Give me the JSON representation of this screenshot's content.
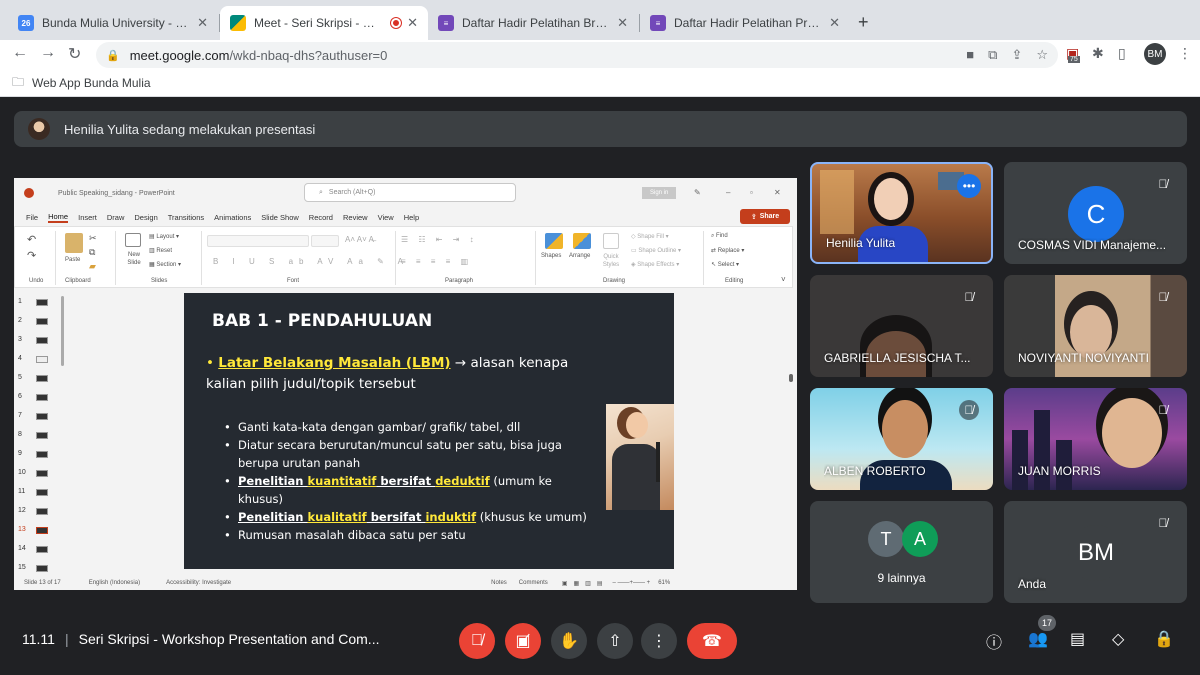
{
  "browser": {
    "tabs": [
      {
        "title": "Bunda Mulia University - Calen",
        "favicon": "calendar-icon",
        "fav_color": "#4285f4",
        "fav_text": "26"
      },
      {
        "title": "Meet - Seri Skripsi - Works",
        "favicon": "meet-icon",
        "fav_color": "#00897b",
        "active": true
      },
      {
        "title": "Daftar Hadir Pelatihan Brevet A",
        "favicon": "forms-icon",
        "fav_color": "#7248b9"
      },
      {
        "title": "Daftar Hadir Pelatihan Present",
        "favicon": "forms-icon",
        "fav_color": "#7248b9"
      }
    ],
    "url_host": "meet.google.com",
    "url_path": "/wkd-nbaq-dhs?authuser=0",
    "bookmark": "Web App Bunda Mulia",
    "profile": "BM",
    "ext_badge": "75"
  },
  "banner": {
    "text": "Henilia Yulita sedang melakukan presentasi"
  },
  "ppt": {
    "title": "Public Speaking_sidang  -  PowerPoint",
    "search_placeholder": "Search (Alt+Q)",
    "signin": "Sign in",
    "menu": [
      "File",
      "Home",
      "Insert",
      "Draw",
      "Design",
      "Transitions",
      "Animations",
      "Slide Show",
      "Record",
      "Review",
      "View",
      "Help"
    ],
    "share": "Share",
    "ribbon_groups": [
      "Undo",
      "Clipboard",
      "Slides",
      "Font",
      "Paragraph",
      "Drawing",
      "Editing"
    ],
    "ribbon_labels": {
      "paste": "Paste",
      "new_slide": "New Slide",
      "layout": "Layout",
      "reset": "Reset",
      "section": "Section",
      "shapes": "Shapes",
      "arrange": "Arrange",
      "quick_styles": "Quick Styles",
      "shape_fill": "Shape Fill",
      "shape_outline": "Shape Outline",
      "shape_effects": "Shape Effects",
      "find": "Find",
      "replace": "Replace",
      "select": "Select"
    },
    "slide_numbers": [
      "1",
      "2",
      "3",
      "4",
      "5",
      "6",
      "7",
      "8",
      "9",
      "10",
      "11",
      "12",
      "13",
      "14",
      "15"
    ],
    "current_slide": "13",
    "status": {
      "slide": "Slide 13 of 17",
      "lang": "English (Indonesia)",
      "access": "Accessibility: Investigate",
      "notes": "Notes",
      "comments": "Comments",
      "zoom": "61%"
    }
  },
  "slide": {
    "heading": "BAB 1 - PENDAHULUAN",
    "lbm": "Latar Belakang Masalah (LBM)",
    "lbm_rest": " → alasan kenapa kalian pilih judul/topik tersebut",
    "b1": "Ganti kata-kata dengan gambar/ grafik/ tabel, dll",
    "b2": "Diatur secara berurutan/muncul satu per satu, bisa juga berupa urutan panah",
    "b3a": "Penelitian ",
    "b3b": "kuantitatif",
    "b3c": " bersifat ",
    "b3d": "deduktif",
    "b3e": " (umum ke khusus)",
    "b4a": "Penelitian ",
    "b4b": "kualitatif",
    "b4c": " bersifat ",
    "b4d": "induktif",
    "b4e": " (khusus ke umum)",
    "b5": "Rumusan masalah dibaca satu per satu"
  },
  "participants": [
    {
      "name": "Henilia Yulita",
      "speaking": true
    },
    {
      "name": "COSMAS VIDI Manajeme...",
      "initial": "C",
      "color": "#1a73e8"
    },
    {
      "name": "GABRIELLA JESISCHA T..."
    },
    {
      "name": "NOVIYANTI NOVIYANTI"
    },
    {
      "name": "ALBEN ROBERTO"
    },
    {
      "name": "JUAN MORRIS"
    }
  ],
  "others": {
    "label": "9 lainnya",
    "a1": "T",
    "a1_color": "#5f6b73",
    "a2": "A",
    "a2_color": "#0f9d58"
  },
  "self": {
    "name": "Anda",
    "initial": "BM",
    "color": "#3c4043"
  },
  "meeting": {
    "time": "11.11",
    "title": "Seri Skripsi - Workshop Presentation and Com...",
    "people_count": "17"
  }
}
